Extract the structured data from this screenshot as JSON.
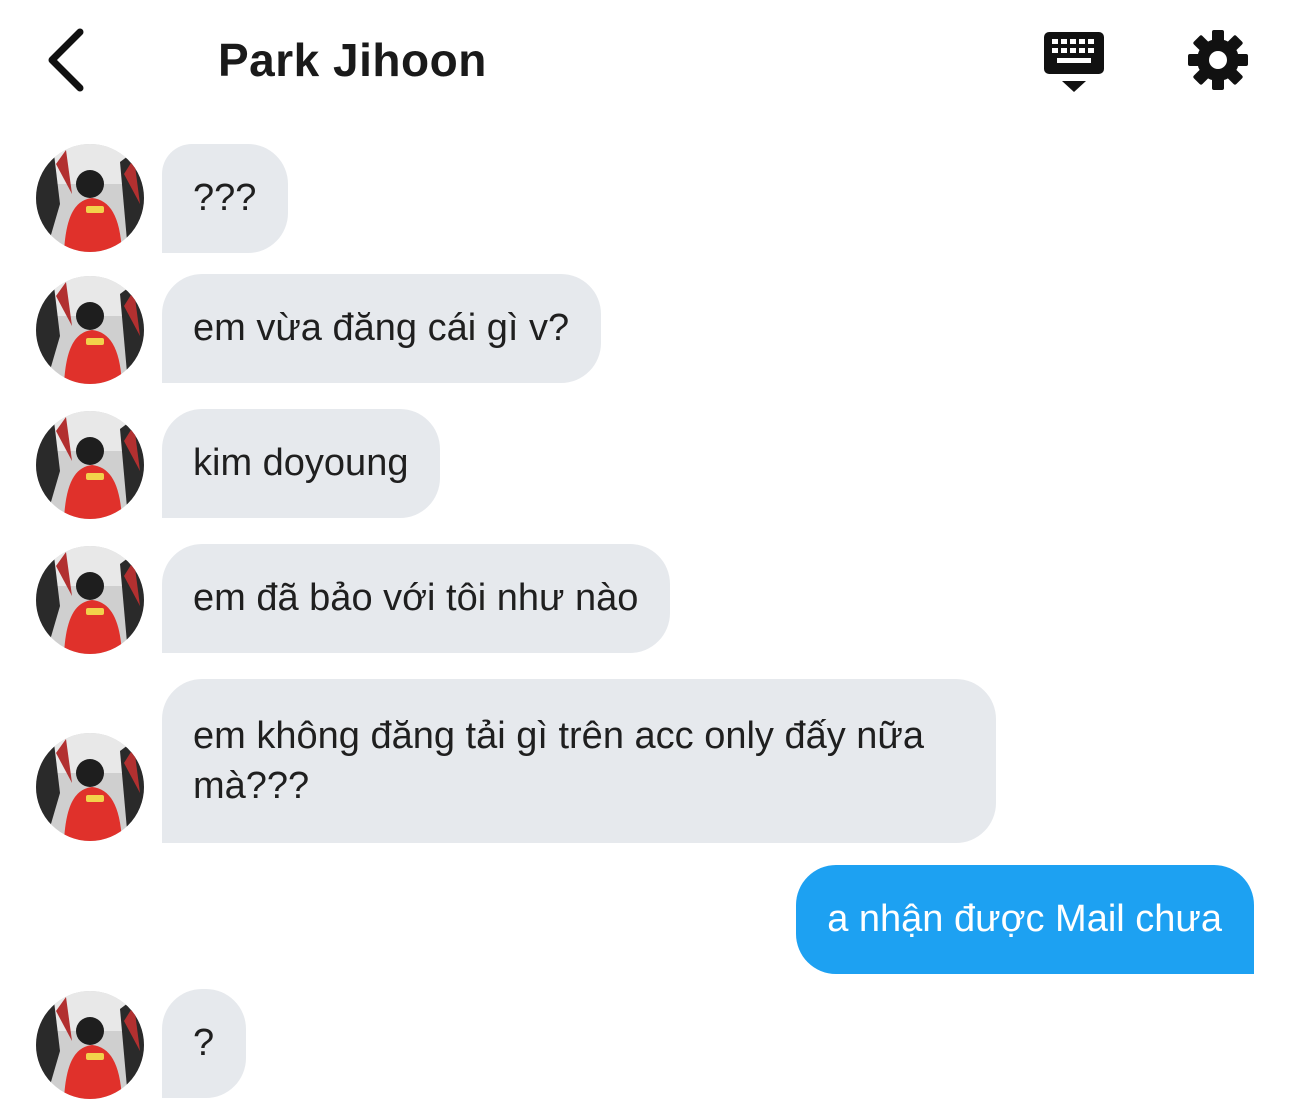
{
  "header": {
    "title": "Park Jihoon",
    "back_icon": "chevron-left-icon",
    "keyboard_icon": "keyboard-icon",
    "settings_icon": "gear-icon"
  },
  "colors": {
    "incoming_bubble": "#e6e9ed",
    "outgoing_bubble": "#1da1f2",
    "text": "#1f1f1f"
  },
  "messages": [
    {
      "direction": "incoming",
      "text": "???"
    },
    {
      "direction": "incoming",
      "text": "em vừa đăng cái gì v?"
    },
    {
      "direction": "incoming",
      "text": "kim doyoung"
    },
    {
      "direction": "incoming",
      "text": "em đã bảo với tôi như nào"
    },
    {
      "direction": "incoming",
      "text": "em không đăng tải gì trên acc only đấy nữa mà???"
    },
    {
      "direction": "outgoing",
      "text": "a nhận được Mail chưa"
    },
    {
      "direction": "incoming",
      "text": "?"
    }
  ]
}
